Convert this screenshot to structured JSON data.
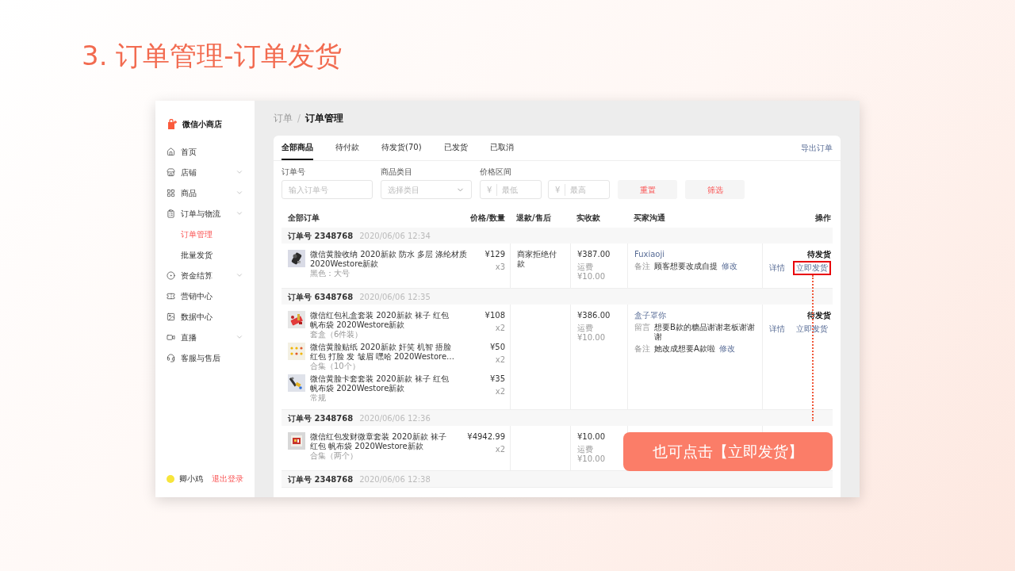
{
  "slide_title": "3. 订单管理-订单发货",
  "app": {
    "name": "微信小商店"
  },
  "sidebar": {
    "items": [
      {
        "label": "首页",
        "kind": "link",
        "selected": false
      },
      {
        "label": "店铺",
        "kind": "group",
        "selected": false
      },
      {
        "label": "商品",
        "kind": "group",
        "selected": false
      },
      {
        "label": "订单与物流",
        "kind": "group",
        "selected": false,
        "children": [
          {
            "label": "订单管理",
            "selected": true
          },
          {
            "label": "批量发货",
            "selected": false
          }
        ]
      },
      {
        "label": "资金结算",
        "kind": "group",
        "selected": false
      },
      {
        "label": "营销中心",
        "kind": "link",
        "selected": false
      },
      {
        "label": "数据中心",
        "kind": "link",
        "selected": false
      },
      {
        "label": "直播",
        "kind": "group",
        "selected": false
      },
      {
        "label": "客服与售后",
        "kind": "link",
        "selected": false
      }
    ]
  },
  "user": {
    "name": "卿小鸡",
    "logout": "退出登录"
  },
  "breadcrumb": {
    "parent": "订单",
    "separator": "/",
    "current": "订单管理"
  },
  "tabs": [
    {
      "label": "全部商品",
      "selected": true
    },
    {
      "label": "待付款",
      "selected": false
    },
    {
      "label": "待发货(70)",
      "selected": false
    },
    {
      "label": "已发货",
      "selected": false
    },
    {
      "label": "已取消",
      "selected": false
    }
  ],
  "export_link": "导出订单",
  "filters": {
    "order_no": {
      "label": "订单号",
      "placeholder": "输入订单号"
    },
    "category": {
      "label": "商品类目",
      "placeholder": "选择类目"
    },
    "price": {
      "label": "价格区间",
      "currency": "¥",
      "min_placeholder": "最低",
      "max_placeholder": "最高"
    },
    "buttons": [
      "重置",
      "筛选"
    ]
  },
  "table": {
    "columns": [
      "全部订单",
      "价格/数量",
      "退款/售后",
      "实收款",
      "买家沟通",
      "操作"
    ],
    "orders": [
      {
        "order_label": "订单号 2348768",
        "time": "2020/06/06 12:34",
        "items": [
          {
            "name_lines": [
              "微信黄脸收纳 2020新款 防水 多层 涤纶材质",
              "2020Westore新款"
            ],
            "spec": "黑色：大号",
            "price": "¥129",
            "qty": "x3"
          }
        ],
        "refund": "商家拒绝付款",
        "received": "¥387.00",
        "shipping": "运费 ¥10.00",
        "buyer": {
          "name": "Fuxiaoji",
          "notes": [
            {
              "label": "备注",
              "text": "顾客想要改成自提",
              "action": "修改"
            }
          ]
        },
        "status": "待发货",
        "actions": [
          {
            "label": "详情",
            "highlighted": false
          },
          {
            "label": "立即发货",
            "highlighted": true
          }
        ]
      },
      {
        "order_label": "订单号 6348768",
        "time": "2020/06/06 12:35",
        "items": [
          {
            "name_lines": [
              "微信红包礼盒套装 2020新款 袜子 红包",
              "帆布袋 2020Westore新款"
            ],
            "spec": "套盒（6件装）",
            "price": "¥108",
            "qty": "x2"
          },
          {
            "name_lines": [
              "微信黄脸贴纸 2020新款 奸笑 机智 捂脸",
              "红包 打脸 发 皱眉 嘿哈 2020Westore…"
            ],
            "spec": "合集（10个）",
            "price": "¥50",
            "qty": "x2"
          },
          {
            "name_lines": [
              "微信黄脸卡套套装 2020新款 袜子 红包",
              "帆布袋 2020Westore新款"
            ],
            "spec": "常规",
            "price": "¥35",
            "qty": "x2"
          }
        ],
        "received": "¥386.00",
        "shipping": "运费 ¥10.00",
        "buyer": {
          "name": "盒子罩你",
          "notes": [
            {
              "label": "留言",
              "text": "想要B款的糖品谢谢老板谢谢谢"
            },
            {
              "label": "备注",
              "text": "她改成想要A款啦",
              "action": "修改"
            }
          ]
        },
        "status": "待发货",
        "actions": [
          {
            "label": "详情",
            "highlighted": false
          },
          {
            "label": "立即发货",
            "highlighted": false
          }
        ]
      },
      {
        "order_label": "订单号 2348768",
        "time": "2020/06/06 12:36",
        "items": [
          {
            "name_lines": [
              "微信红包发财微章套装 2020新款 袜子",
              "红包 帆布袋 2020Westore新款"
            ],
            "spec": "合集（两个）",
            "price": "¥4942.99",
            "qty": "x2"
          }
        ],
        "received": "¥10.00",
        "shipping": "运费 ¥10.00"
      },
      {
        "order_label": "订单号 2348768",
        "time": "2020/06/06 12:38"
      }
    ]
  },
  "callout": "也可点击【立即发货】"
}
